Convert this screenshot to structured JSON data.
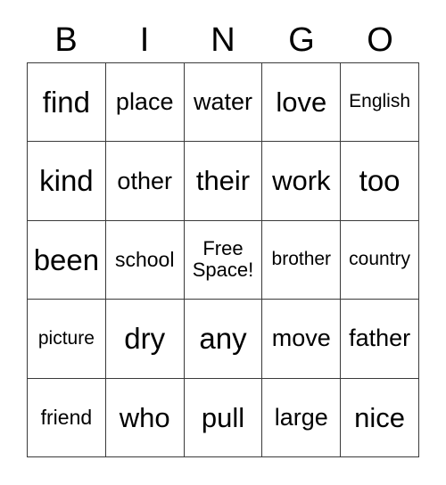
{
  "card": {
    "title": "BINGO",
    "header_letters": [
      "B",
      "I",
      "N",
      "G",
      "O"
    ],
    "colors": {
      "background": "#ffffff",
      "text": "#000000",
      "grid_line": "#3a3a3a"
    },
    "grid_size": "5x5",
    "free_space": {
      "row": 3,
      "column": 3,
      "label": "Free\nSpace!"
    },
    "rows": [
      {
        "cells": [
          {
            "text": "find",
            "size": "xl"
          },
          {
            "text": "place",
            "size": "md"
          },
          {
            "text": "water",
            "size": "md"
          },
          {
            "text": "love",
            "size": "lg"
          },
          {
            "text": "English",
            "size": "xs"
          }
        ]
      },
      {
        "cells": [
          {
            "text": "kind",
            "size": "xl"
          },
          {
            "text": "other",
            "size": "md"
          },
          {
            "text": "their",
            "size": "lg"
          },
          {
            "text": "work",
            "size": "lg"
          },
          {
            "text": "too",
            "size": "xl"
          }
        ]
      },
      {
        "cells": [
          {
            "text": "been",
            "size": "xl"
          },
          {
            "text": "school",
            "size": "sm"
          },
          {
            "text": "Free\nSpace!",
            "size": "free"
          },
          {
            "text": "brother",
            "size": "xs"
          },
          {
            "text": "country",
            "size": "xs"
          }
        ]
      },
      {
        "cells": [
          {
            "text": "picture",
            "size": "xs"
          },
          {
            "text": "dry",
            "size": "xl"
          },
          {
            "text": "any",
            "size": "xl"
          },
          {
            "text": "move",
            "size": "md"
          },
          {
            "text": "father",
            "size": "md"
          }
        ]
      },
      {
        "cells": [
          {
            "text": "friend",
            "size": "sm"
          },
          {
            "text": "who",
            "size": "lg"
          },
          {
            "text": "pull",
            "size": "lg"
          },
          {
            "text": "large",
            "size": "md"
          },
          {
            "text": "nice",
            "size": "lg"
          }
        ]
      }
    ]
  }
}
